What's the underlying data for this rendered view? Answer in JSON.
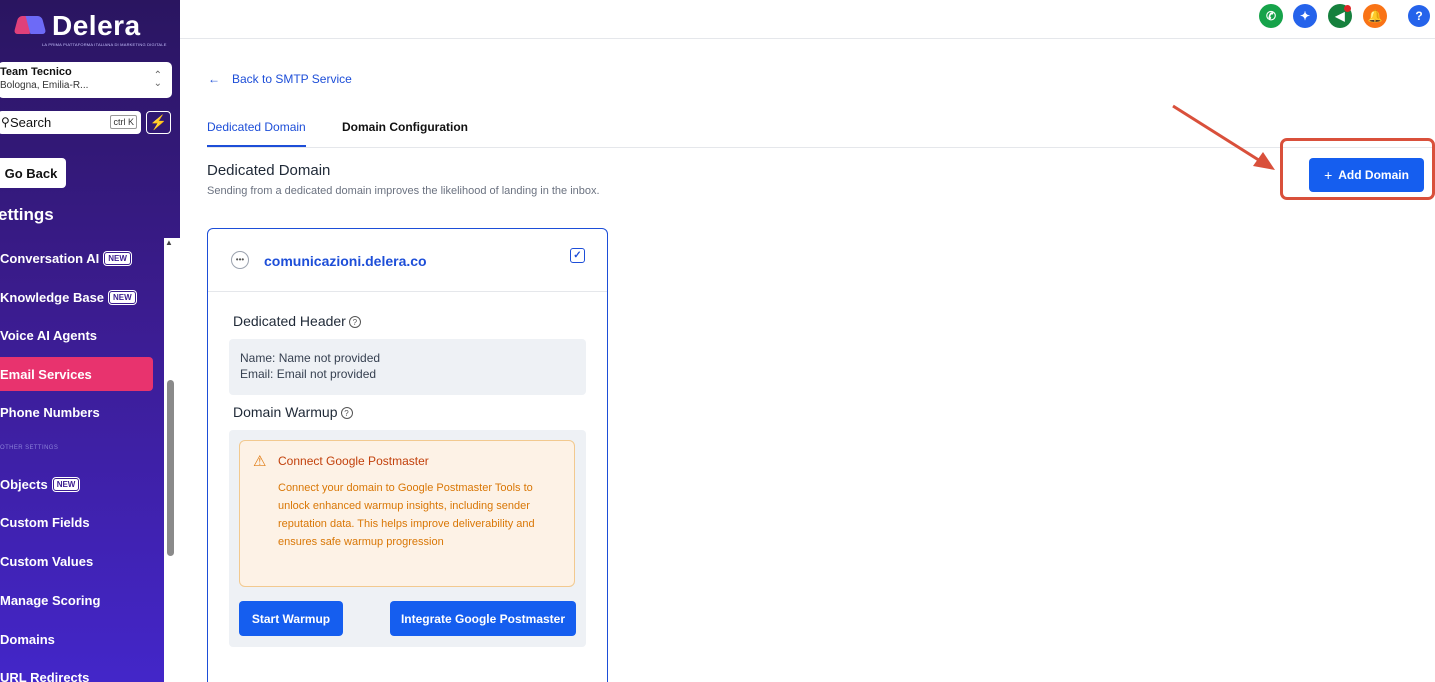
{
  "brand": {
    "name": "Delera",
    "tagline": "LA PRIMA PIATTAFORMA ITALIANA DI MARKETING DIGITALE"
  },
  "location": {
    "name": "Team Tecnico",
    "subtitle": "Bologna, Emilia-R..."
  },
  "search": {
    "label": "Search",
    "shortcut": "ctrl K"
  },
  "sidebar": {
    "go_back": "Go Back",
    "title": "ettings",
    "section_other": "OTHER SETTINGS",
    "badge": "NEW",
    "items": [
      {
        "label": "Conversation AI",
        "new": true
      },
      {
        "label": "Knowledge Base",
        "new": true
      },
      {
        "label": "Voice AI Agents",
        "new": false
      },
      {
        "label": "Email Services",
        "new": false,
        "active": true
      },
      {
        "label": "Phone Numbers",
        "new": false
      },
      {
        "label": "Objects",
        "new": true
      },
      {
        "label": "Custom Fields",
        "new": false
      },
      {
        "label": "Custom Values",
        "new": false
      },
      {
        "label": "Manage Scoring",
        "new": false
      },
      {
        "label": "Domains",
        "new": false
      },
      {
        "label": "URL Redirects",
        "new": false
      }
    ]
  },
  "header": {
    "icons": [
      "phone-icon",
      "ai-sparkle-icon",
      "megaphone-icon",
      "bell-icon",
      "help-icon"
    ],
    "help_label": "?"
  },
  "main": {
    "back_link": "Back to SMTP Service",
    "tabs": [
      {
        "label": "Dedicated Domain",
        "active": true
      },
      {
        "label": "Domain Configuration",
        "active": false
      }
    ],
    "title": "Dedicated Domain",
    "description": "Sending from a dedicated domain improves the likelihood of landing in the inbox.",
    "add_button": "Add Domain"
  },
  "domain_card": {
    "domain": "comunicazioni.delera.co",
    "dedicated_header": {
      "title": "Dedicated Header",
      "name_label": "Name:",
      "name_value": "Name not provided",
      "email_label": "Email:",
      "email_value": "Email not provided"
    },
    "warmup": {
      "title": "Domain Warmup",
      "alert_title": "Connect Google Postmaster",
      "alert_body": "Connect your domain to Google Postmaster Tools to unlock enhanced warmup insights, including sender reputation data. This helps improve deliverability and ensures safe warmup progression",
      "start_button": "Start Warmup",
      "integrate_button": "Integrate Google Postmaster"
    }
  },
  "colors": {
    "primary": "#155eef",
    "sidebar_active": "#e8336e",
    "highlight": "#d9503b",
    "alert_text": "#d97706"
  }
}
